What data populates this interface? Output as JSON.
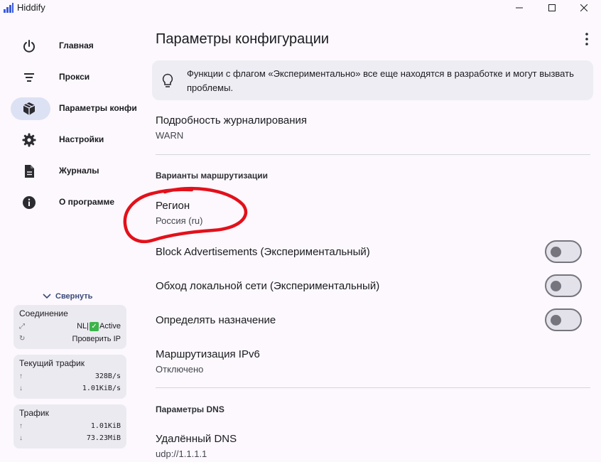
{
  "window": {
    "title": "Hiddify"
  },
  "sidebar": {
    "items": [
      {
        "label": "Главная",
        "icon": "power-icon"
      },
      {
        "label": "Прокси",
        "icon": "filter-list-icon"
      },
      {
        "label": "Параметры конфи",
        "icon": "cube-icon"
      },
      {
        "label": "Настройки",
        "icon": "gear-icon"
      },
      {
        "label": "Журналы",
        "icon": "document-icon"
      },
      {
        "label": "О программе",
        "icon": "info-icon"
      }
    ],
    "collapse_label": "Свернуть",
    "connection": {
      "title": "Соединение",
      "location": "NL|",
      "status": "Active",
      "check_ip": "Проверить IP"
    },
    "current_traffic": {
      "title": "Текущий трафик",
      "up": "328B/s",
      "down": "1.01KiB/s"
    },
    "traffic": {
      "title": "Трафик",
      "up": "1.01KiB",
      "down": "73.23MiB"
    }
  },
  "main": {
    "title": "Параметры конфигурации",
    "banner": "Функции с флагом «Экспериментально» все еще находятся в разработке и могут вызвать проблемы.",
    "log_level": {
      "title": "Подробность журналирования",
      "value": "WARN"
    },
    "routing_section": "Варианты маршрутизации",
    "region": {
      "title": "Регион",
      "value": "Россия (ru)"
    },
    "block_ads": {
      "title": "Block Advertisements (Экспериментальный)",
      "on": false
    },
    "bypass_lan": {
      "title": "Обход локальной сети (Экспериментальный)",
      "on": false
    },
    "resolve_dest": {
      "title": "Определять назначение",
      "on": false
    },
    "ipv6": {
      "title": "Маршрутизация IPv6",
      "value": "Отключено"
    },
    "dns_section": "Параметры DNS",
    "remote_dns": {
      "title": "Удалённый DNS",
      "value": "udp://1.1.1.1"
    }
  },
  "colors": {
    "accent": "#3a4a7a",
    "active_pill": "#dde1f4",
    "annotation": "#e3101b"
  }
}
